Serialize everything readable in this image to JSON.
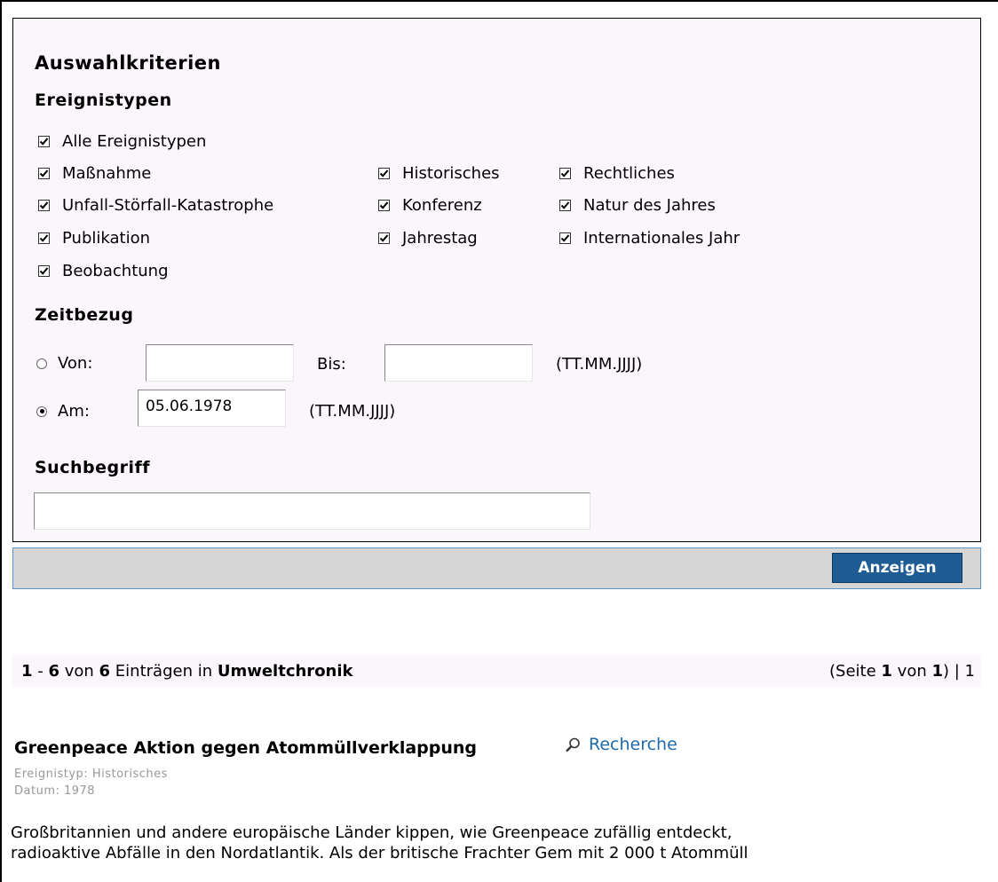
{
  "criteria": {
    "title": "Auswahlkriterien",
    "event_types": {
      "heading": "Ereignistypen",
      "all": {
        "label": "Alle Ereignistypen",
        "checked": true
      },
      "items": [
        {
          "label": "Maßnahme",
          "checked": true
        },
        {
          "label": "Historisches",
          "checked": true
        },
        {
          "label": "Rechtliches",
          "checked": true
        },
        {
          "label": "Unfall-Störfall-Katastrophe",
          "checked": true
        },
        {
          "label": "Konferenz",
          "checked": true
        },
        {
          "label": "Natur des Jahres",
          "checked": true
        },
        {
          "label": "Publikation",
          "checked": true
        },
        {
          "label": "Jahrestag",
          "checked": true
        },
        {
          "label": "Internationales Jahr",
          "checked": true
        },
        {
          "label": "Beobachtung",
          "checked": true
        }
      ]
    },
    "time": {
      "heading": "Zeitbezug",
      "from_label": "Von:",
      "to_label": "Bis:",
      "from_value": "",
      "to_value": "",
      "range_hint": "(TT.MM.JJJJ)",
      "on_label": "Am:",
      "on_value": "05.06.1978",
      "on_hint": "(TT.MM.JJJJ)",
      "selected": "on"
    },
    "search": {
      "heading": "Suchbegriff",
      "value": ""
    }
  },
  "actions": {
    "show_label": "Anzeigen"
  },
  "results": {
    "range_start": "1",
    "range_sep": " - ",
    "range_end": "6",
    "of_word": " von ",
    "total": "6",
    "in_text": " Einträgen in ",
    "collection": "Umweltchronik",
    "page_prefix": "(Seite ",
    "page_current": "1",
    "page_of": " von ",
    "page_total": "1",
    "page_suffix": ") | 1"
  },
  "entry": {
    "title": "Greenpeace Aktion gegen Atommüllverklappung",
    "research_label": "Recherche",
    "research_icon": "magnifier-icon",
    "type": "Ereignistyp: Historisches",
    "date": "Datum: 1978",
    "line1": "Großbritannien und andere europäische Länder kippen, wie Greenpeace zufällig entdeckt,",
    "line2": "radioaktive Abfälle in den Nordatlantik. Als der britische Frachter Gem mit 2 000 t Atommüll"
  },
  "colors": {
    "panel_bg": "#fbf6fb",
    "button_bg": "#1f5c93",
    "bar_bg": "#d6d6d6",
    "link": "#1f6aa8",
    "meta_text": "#999999"
  }
}
